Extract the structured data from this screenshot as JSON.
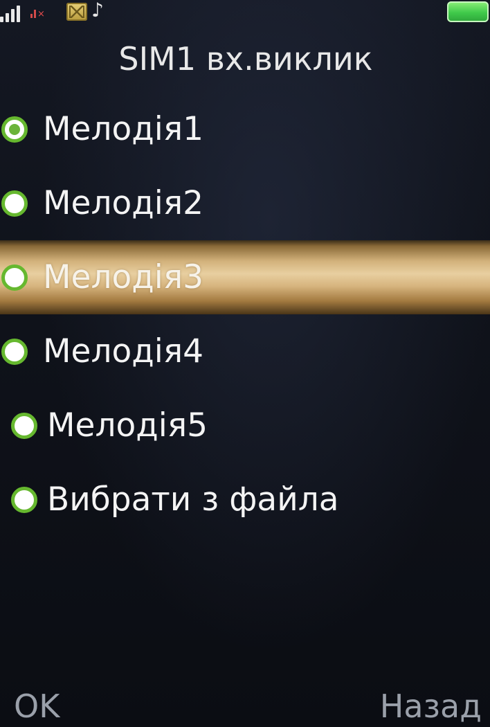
{
  "status_bar": {
    "icons": [
      "signal-strength-icon",
      "sim2-no-signal-icon",
      "message-icon",
      "music-note-icon",
      "battery-icon"
    ]
  },
  "screen": {
    "title": "SIM1 вх.виклик"
  },
  "list": {
    "items": [
      {
        "label": "Мелодія1",
        "checked": true,
        "selected": false
      },
      {
        "label": "Мелодія2",
        "checked": false,
        "selected": false
      },
      {
        "label": "Мелодія3",
        "checked": false,
        "selected": true
      },
      {
        "label": "Мелодія4",
        "checked": false,
        "selected": false
      },
      {
        "label": "Мелодія5",
        "checked": false,
        "selected": false
      },
      {
        "label": "Вибрати з файла",
        "checked": false,
        "selected": false
      }
    ]
  },
  "softkeys": {
    "left": "OK",
    "right": "Назад"
  },
  "colors": {
    "background": "#0f121a",
    "highlight": "#e8cfa0",
    "radio_ring": "#66b82f",
    "battery": "#3fc94a",
    "softkey_text": "#9aa0aa"
  }
}
